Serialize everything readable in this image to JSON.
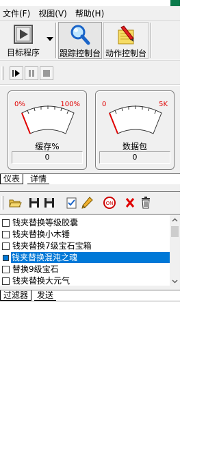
{
  "menu": [
    {
      "label": "文件(F)"
    },
    {
      "label": "视图(V)"
    },
    {
      "label": "帮助(H)"
    }
  ],
  "toolbar": {
    "target_label": "目标程序",
    "trace_label": "跟踪控制台",
    "action_label": "动作控制台"
  },
  "gauges": [
    {
      "min_label": "0%",
      "max_label": "100%",
      "title": "缓存%",
      "value": "0"
    },
    {
      "min_label": "0",
      "max_label": "5K",
      "title": "数据包",
      "value": "0"
    }
  ],
  "top_tabs": [
    {
      "label": "仪表"
    },
    {
      "label": "详情"
    }
  ],
  "list_items": [
    {
      "label": "钱夹替换等级胶囊",
      "checked": false,
      "selected": false
    },
    {
      "label": "钱夹替换小木锤",
      "checked": false,
      "selected": false
    },
    {
      "label": "钱夹替换7级宝石宝箱",
      "checked": false,
      "selected": false
    },
    {
      "label": "钱夹替换混沌之魂",
      "checked": false,
      "selected": true
    },
    {
      "label": "替换9级宝石",
      "checked": false,
      "selected": false
    },
    {
      "label": "钱夹替换大元气",
      "checked": false,
      "selected": false
    }
  ],
  "bottom_tabs": [
    {
      "label": "过滤器"
    },
    {
      "label": "发送"
    }
  ],
  "colors": {
    "title_accent": "#0a7a4b",
    "gauge_label_red": "#e00000",
    "selection_blue": "#0078d7"
  }
}
